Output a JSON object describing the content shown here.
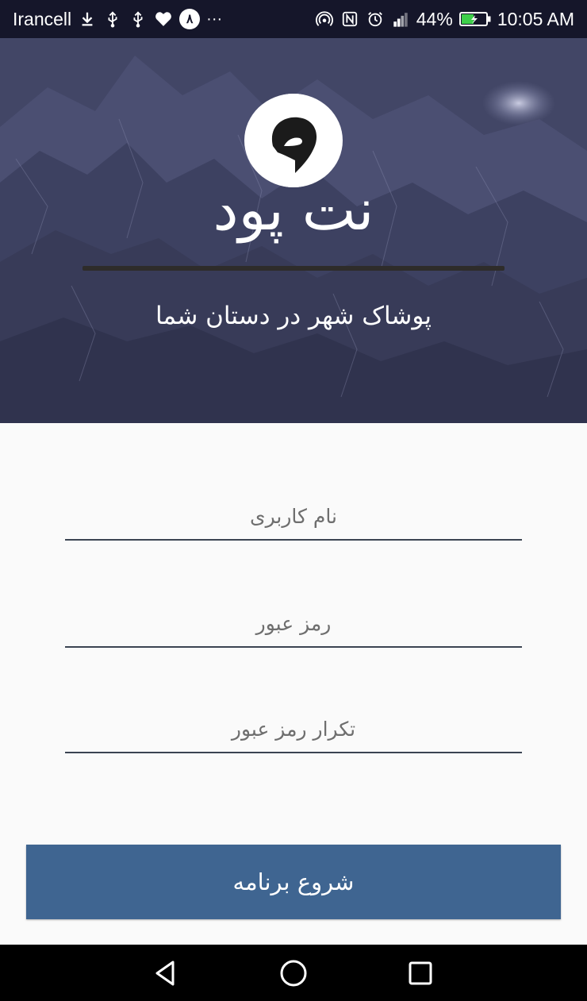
{
  "status_bar": {
    "carrier": "Irancell",
    "notification_count": "۸",
    "more": "···",
    "battery_percent": "44%",
    "time": "10:05 AM",
    "icons_left": [
      "download-icon",
      "usb-icon",
      "usb-icon",
      "health-icon",
      "badge-icon",
      "more-icon"
    ],
    "icons_right": [
      "hotspot-icon",
      "nfc-icon",
      "alarm-icon",
      "signal-icon",
      "battery-icon"
    ]
  },
  "hero": {
    "brand": "نت پود",
    "tagline": "پوشاک شهر در دستان شما",
    "logo_icon": "brand-logo-icon"
  },
  "form": {
    "username_placeholder": "نام کاربری",
    "password_placeholder": "رمز عبور",
    "confirm_password_placeholder": "تکرار رمز عبور",
    "start_label": "شروع برنامه"
  },
  "nav": {
    "back_icon": "back-triangle-icon",
    "home_icon": "home-circle-icon",
    "recents_icon": "recents-square-icon"
  },
  "colors": {
    "hero_bg": "#3f4363",
    "button": "#3f6591",
    "field_line": "#3b4452",
    "status_bar": "#15162a"
  }
}
